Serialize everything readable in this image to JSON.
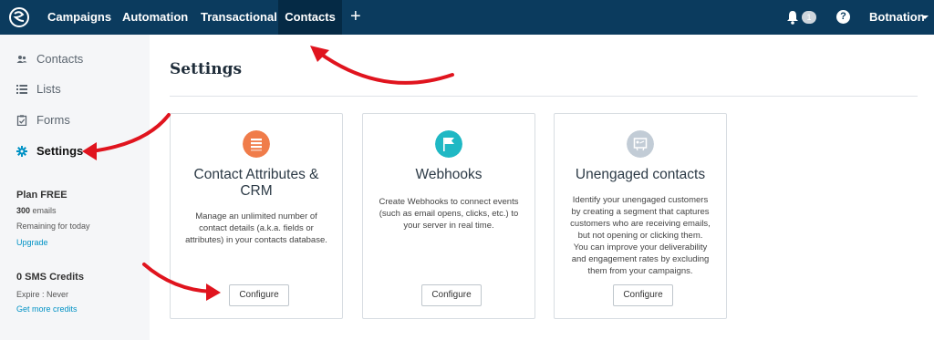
{
  "topnav": {
    "items": [
      "Campaigns",
      "Automation",
      "Transactional",
      "Contacts"
    ],
    "plus": "+",
    "notification_count": "1",
    "help": "?",
    "user": "Botnation"
  },
  "sidebar": {
    "items": [
      {
        "label": "Contacts",
        "icon": "people-icon"
      },
      {
        "label": "Lists",
        "icon": "list-icon"
      },
      {
        "label": "Forms",
        "icon": "clipboard-icon"
      },
      {
        "label": "Settings",
        "icon": "gear-icon"
      }
    ],
    "plan": {
      "title": "Plan FREE",
      "emails_count": "300",
      "emails_unit": "emails",
      "remaining": "Remaining for today",
      "upgrade": "Upgrade"
    },
    "sms": {
      "title": "0 SMS Credits",
      "expire": "Expire : Never",
      "get_more": "Get more credits"
    }
  },
  "main": {
    "title": "Settings",
    "cards": [
      {
        "title_line1": "Contact Attributes &",
        "title_line2": "CRM",
        "desc": [
          "Manage an unlimited number of",
          "contact details (a.k.a. fields or",
          "attributes) in your contacts database."
        ],
        "button": "Configure",
        "icon_color": "#f07c4a"
      },
      {
        "title_line1": "Webhooks",
        "desc": [
          "Create Webhooks to connect events",
          "(such as email opens, clicks, etc.) to",
          "your server in real time."
        ],
        "button": "Configure",
        "icon_color": "#1fb8c4"
      },
      {
        "title_line1": "Unengaged contacts",
        "desc": [
          "Identify your unengaged customers",
          "by creating a segment that captures",
          "customers who are receiving emails,",
          "but not opening or clicking them.",
          "You can improve your deliverability",
          "and engagement rates by excluding",
          "them from your campaigns."
        ],
        "button": "Configure",
        "icon_color": "#c2ccd6"
      }
    ]
  },
  "colors": {
    "nav_bg": "#0b3b5e",
    "nav_active": "#052a45",
    "accent": "#0092c5",
    "annotation_arrow": "#e0141e"
  }
}
